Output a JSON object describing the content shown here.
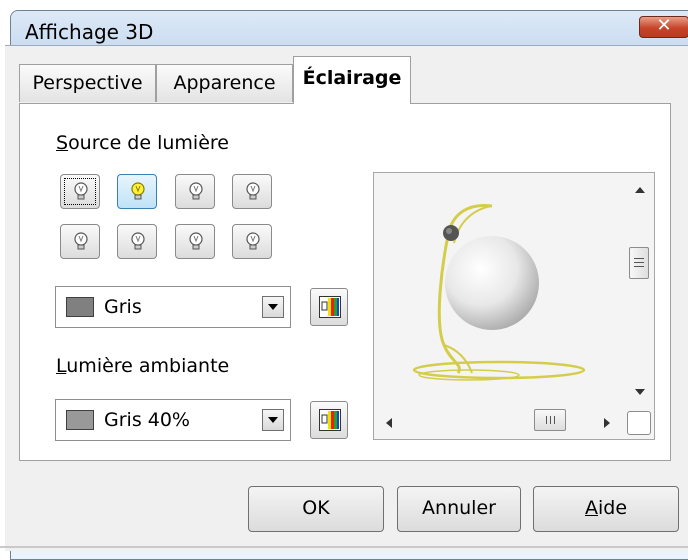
{
  "window": {
    "title": "Affichage 3D",
    "close_glyph": "✕"
  },
  "tabs": [
    {
      "label": "Perspective",
      "active": false
    },
    {
      "label": "Apparence",
      "active": false
    },
    {
      "label": "Éclairage",
      "active": true
    }
  ],
  "light_source": {
    "label_underlined": "S",
    "label_rest": "ource de lumière",
    "bulbs": [
      {
        "state": "focused-off"
      },
      {
        "state": "selected-on"
      },
      {
        "state": "off"
      },
      {
        "state": "off"
      },
      {
        "state": "off"
      },
      {
        "state": "off"
      },
      {
        "state": "off"
      },
      {
        "state": "off"
      }
    ],
    "color_value": "Gris",
    "color_hex": "#808080"
  },
  "ambient_light": {
    "label_underlined": "L",
    "label_rest": "umière ambiante",
    "color_value": "Gris 40%",
    "color_hex": "#999999"
  },
  "preview": {
    "icons": [
      "sphere-preview",
      "light-handle-icon",
      "scroll-arrow-up-icon",
      "scroll-arrow-down-icon",
      "scroll-arrow-left-icon",
      "scroll-arrow-right-icon"
    ]
  },
  "buttons": {
    "ok": "OK",
    "cancel": "Annuler",
    "help_underlined": "A",
    "help_rest": "ide"
  }
}
